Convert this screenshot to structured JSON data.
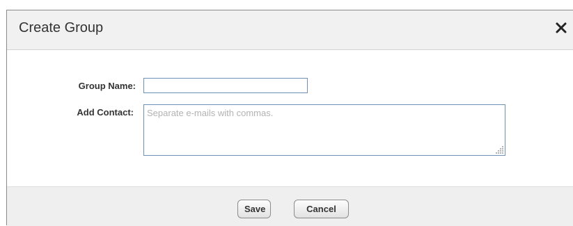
{
  "dialog": {
    "title": "Create Group",
    "close_label": "Close"
  },
  "form": {
    "group_name_label": "Group Name:",
    "group_name_value": "",
    "add_contact_label": "Add Contact:",
    "add_contact_value": "",
    "add_contact_placeholder": "Separate e-mails with commas."
  },
  "footer": {
    "save_label": "Save",
    "cancel_label": "Cancel"
  },
  "colors": {
    "header_bg": "#f1f1f1",
    "footer_bg": "#efefef",
    "input_border": "#6f90b5"
  },
  "icons": {
    "close": "close-icon",
    "resize": "resize-grip-icon"
  }
}
